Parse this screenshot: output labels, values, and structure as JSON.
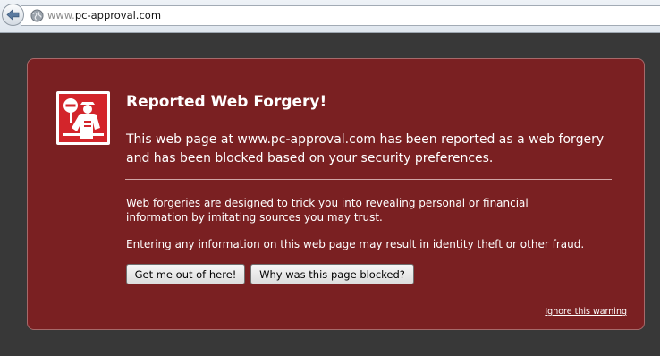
{
  "browser": {
    "url_prefix": "www.",
    "url_domain": "pc-approval.com",
    "back_icon": "back-arrow-icon",
    "site_icon": "globe-icon"
  },
  "warning": {
    "icon": "forgery-officer-icon",
    "title": "Reported Web Forgery!",
    "lead": "This web page at www.pc-approval.com has been reported as a web forgery and has been blocked based on your security preferences.",
    "paragraph_1": "Web forgeries are designed to trick you into revealing personal or financial information by imitating sources you may trust.",
    "paragraph_2": "Entering any information on this web page may result in identity theft or other fraud.",
    "button_get_out": "Get me out of here!",
    "button_why_blocked": "Why was this page blocked?",
    "ignore_link": "Ignore this warning"
  },
  "colors": {
    "panel_background": "#7a2022",
    "page_background": "#383838",
    "badge_red": "#d3252b"
  }
}
